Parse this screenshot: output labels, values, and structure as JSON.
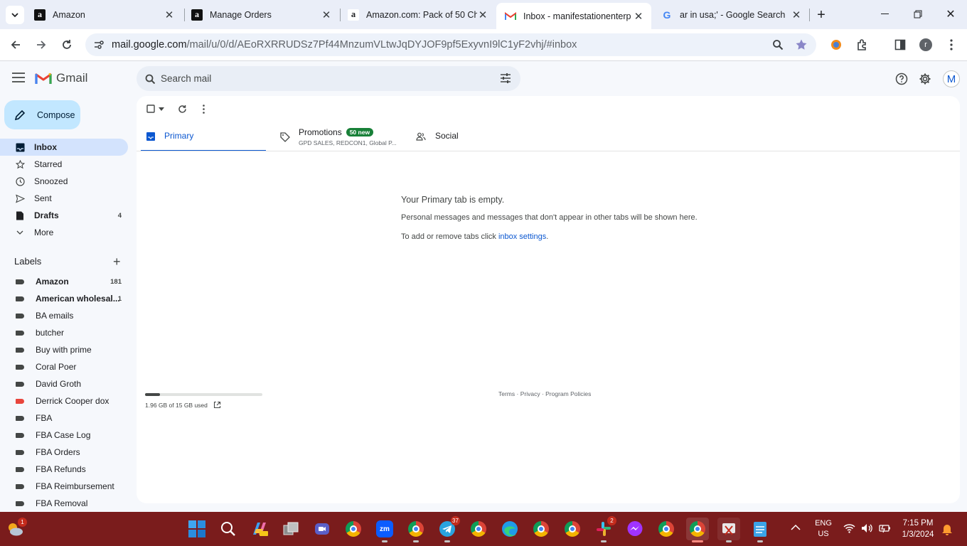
{
  "browser": {
    "tabs": [
      {
        "title": "Amazon",
        "favicon": "amazon-favicon",
        "active": false
      },
      {
        "title": "Manage Orders",
        "favicon": "amazon-favicon",
        "active": false
      },
      {
        "title": "Amazon.com: Pack of 50 Ch",
        "favicon": "amazon-favicon",
        "active": false
      },
      {
        "title": "Inbox - manifestationenterp",
        "favicon": "gmail-favicon",
        "active": true
      },
      {
        "title": "ar in usa;' - Google Search",
        "favicon": "google-favicon",
        "active": false
      }
    ],
    "url_host": "mail.google.com",
    "url_path": "/mail/u/0/d/AEoRXRRUDSz7Pf44MnzumVLtwJqDYJOF9pf5ExyvnI9lC1yF2vhj/#inbox",
    "profile_initial": "r"
  },
  "gmail": {
    "product_name": "Gmail",
    "search_placeholder": "Search mail",
    "account_initial": "M",
    "compose_label": "Compose",
    "nav": [
      {
        "label": "Inbox",
        "icon": "inbox-icon",
        "count": "",
        "selected": true
      },
      {
        "label": "Starred",
        "icon": "star-icon",
        "count": ""
      },
      {
        "label": "Snoozed",
        "icon": "clock-icon",
        "count": ""
      },
      {
        "label": "Sent",
        "icon": "send-icon",
        "count": ""
      },
      {
        "label": "Drafts",
        "icon": "draft-icon",
        "count": "4"
      },
      {
        "label": "More",
        "icon": "chevron-down-icon",
        "count": ""
      }
    ],
    "labels_heading": "Labels",
    "labels": [
      {
        "name": "Amazon",
        "count": "181",
        "bold": true,
        "color": "#444746"
      },
      {
        "name": "American wholesal...",
        "count": "1",
        "bold": true,
        "color": "#444746"
      },
      {
        "name": "BA emails",
        "count": "",
        "color": "#444746"
      },
      {
        "name": "butcher",
        "count": "",
        "color": "#444746"
      },
      {
        "name": "Buy with prime",
        "count": "",
        "color": "#444746"
      },
      {
        "name": "Coral Poer",
        "count": "",
        "color": "#444746"
      },
      {
        "name": "David Groth",
        "count": "",
        "color": "#444746"
      },
      {
        "name": "Derrick Cooper dox",
        "count": "",
        "color": "#e8453c"
      },
      {
        "name": "FBA",
        "count": "",
        "color": "#444746"
      },
      {
        "name": "FBA Case Log",
        "count": "",
        "color": "#444746"
      },
      {
        "name": "FBA Orders",
        "count": "",
        "color": "#444746"
      },
      {
        "name": "FBA Refunds",
        "count": "",
        "color": "#444746"
      },
      {
        "name": "FBA Reimbursement",
        "count": "",
        "color": "#444746"
      },
      {
        "name": "FBA Removal",
        "count": "",
        "color": "#444746"
      }
    ],
    "tabs": {
      "primary": "Primary",
      "promotions": "Promotions",
      "promotions_badge": "50 new",
      "promotions_snippet": "GPD SALES, REDCON1, Global P...",
      "social": "Social"
    },
    "empty": {
      "title": "Your Primary tab is empty.",
      "line1": "Personal messages and messages that don't appear in other tabs will be shown here.",
      "line2_prefix": "To add or remove tabs click ",
      "line2_link": "inbox settings",
      "line2_suffix": "."
    },
    "storage": {
      "text": "1.96 GB of 15 GB used",
      "fraction_used": 0.13
    },
    "footer": {
      "terms": "Terms",
      "privacy": "Privacy",
      "policies": "Program Policies",
      "separator": " · "
    }
  },
  "taskbar": {
    "language": "ENG",
    "region": "US",
    "time": "7:15 PM",
    "date": "1/3/2024",
    "badges": {
      "telegram": "37",
      "slack": "2",
      "notification": "1"
    }
  },
  "colors": {
    "accent": "#0b57d0",
    "compose_bg": "#c2e7ff",
    "selected_nav": "#d3e3fd",
    "promo_badge": "#188038",
    "taskbar": "#7a1c1c"
  }
}
